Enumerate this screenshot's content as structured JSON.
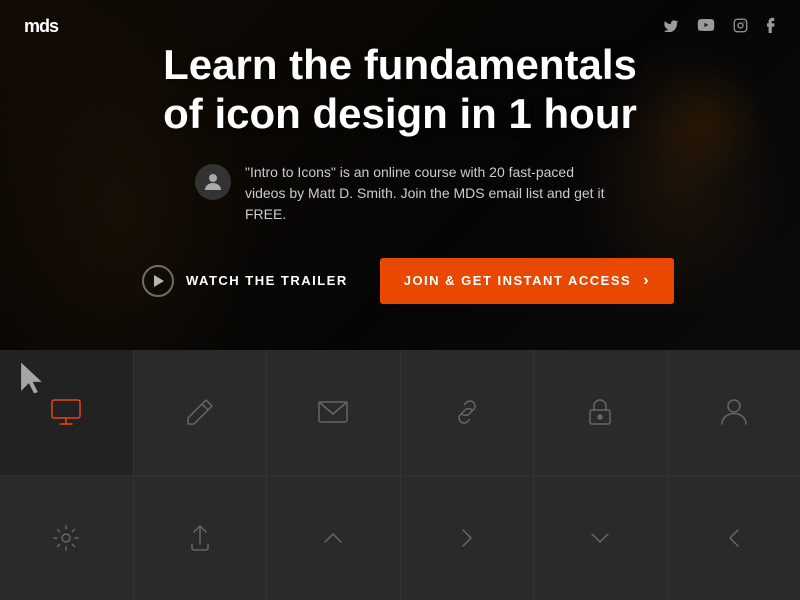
{
  "navbar": {
    "logo": "mds",
    "social": [
      {
        "name": "twitter",
        "label": "t"
      },
      {
        "name": "youtube",
        "label": "▶"
      },
      {
        "name": "instagram",
        "label": "◻"
      },
      {
        "name": "facebook",
        "label": "f"
      }
    ]
  },
  "hero": {
    "title_line1": "Learn the fundamentals",
    "title_line2": "of icon design in 1 hour",
    "description": "\"Intro to Icons\" is an online course with 20 fast-paced videos by Matt D. Smith. Join the MDS email list and get it FREE.",
    "btn_trailer": "WATCH THE TRAILER",
    "btn_join": "JOIN & GET INSTANT ACCESS",
    "colors": {
      "accent": "#e84800"
    }
  },
  "icon_grid": {
    "row1": [
      {
        "id": "screen-icon",
        "active": true
      },
      {
        "id": "edit-icon",
        "active": false
      },
      {
        "id": "mail-icon",
        "active": false
      },
      {
        "id": "link-icon",
        "active": false
      },
      {
        "id": "lock-icon",
        "active": false
      },
      {
        "id": "user-icon",
        "active": false
      }
    ],
    "row2": [
      {
        "id": "settings-icon",
        "active": false
      },
      {
        "id": "upload-icon",
        "active": false
      },
      {
        "id": "chevron-up-icon",
        "active": false
      },
      {
        "id": "chevron-right-icon",
        "active": false
      },
      {
        "id": "chevron-down-icon",
        "active": false
      },
      {
        "id": "chevron-left-icon",
        "active": false
      }
    ]
  }
}
